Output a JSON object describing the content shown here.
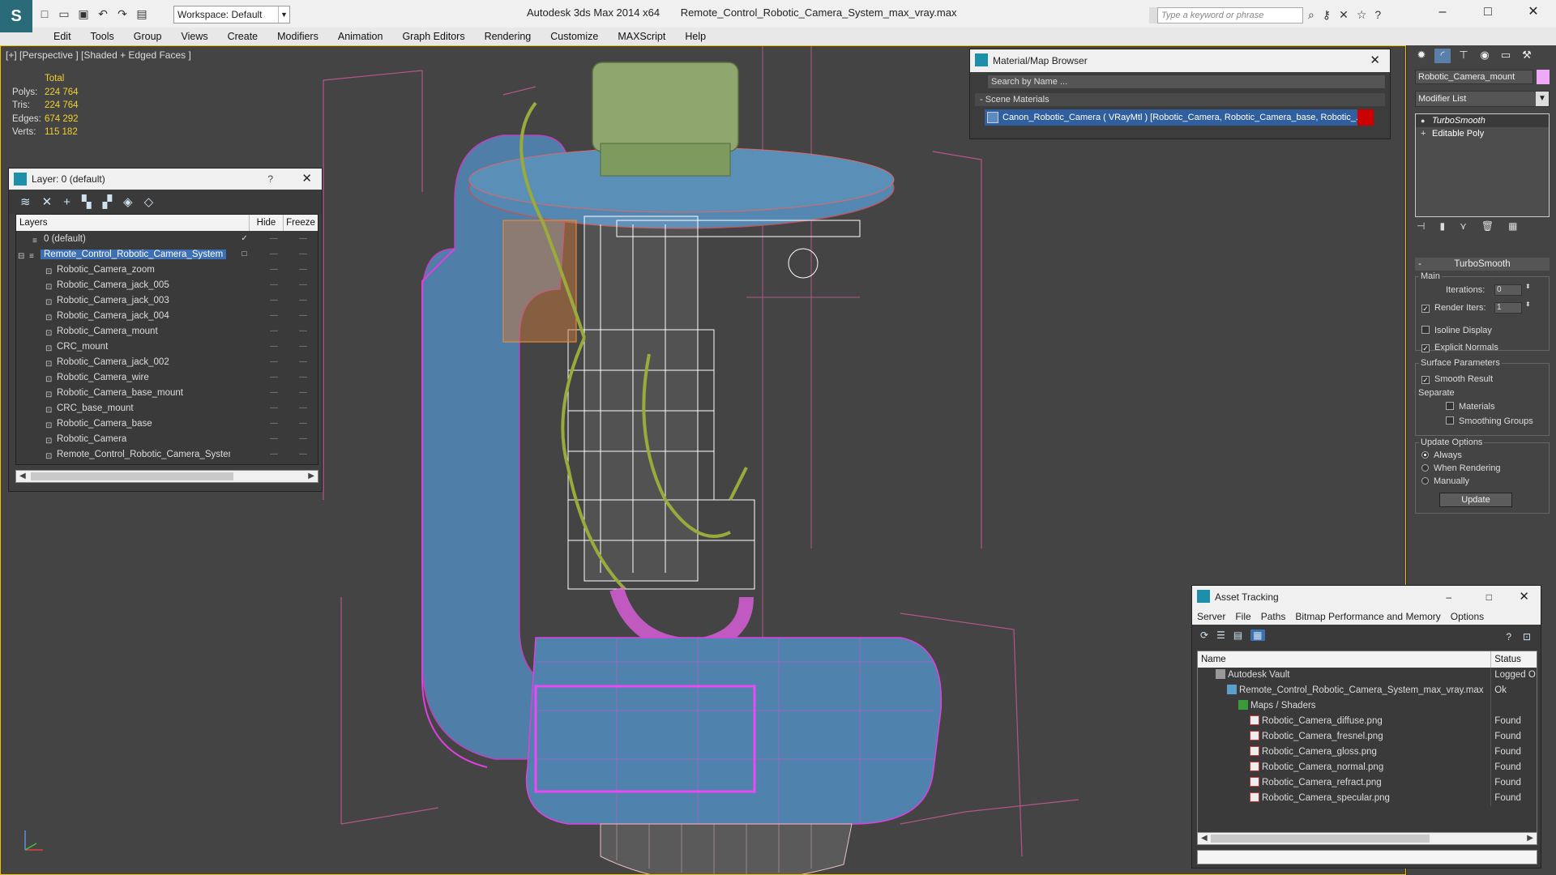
{
  "titlebar": {
    "workspace": "Workspace: Default",
    "app_name": "Autodesk 3ds Max  2014 x64",
    "file_name": "Remote_Control_Robotic_Camera_System_max_vray.max",
    "search_placeholder": "Type a keyword or phrase"
  },
  "menu": [
    "Edit",
    "Tools",
    "Group",
    "Views",
    "Create",
    "Modifiers",
    "Animation",
    "Graph Editors",
    "Rendering",
    "Customize",
    "MAXScript",
    "Help"
  ],
  "viewport": {
    "label": "[+] [Perspective ] [Shaded + Edged Faces ]",
    "stats": {
      "header": "Total",
      "polys_label": "Polys:",
      "polys": "224 764",
      "tris_label": "Tris:",
      "tris": "224 764",
      "edges_label": "Edges:",
      "edges": "674 292",
      "verts_label": "Verts:",
      "verts": "115 182"
    }
  },
  "layer_panel": {
    "title": "Layer: 0 (default)",
    "help": "?",
    "col_layers": "Layers",
    "col_hide": "Hide",
    "col_freeze": "Freeze",
    "dash": "—",
    "rows": [
      {
        "name": "0 (default)"
      },
      {
        "name": "Remote_Control_Robotic_Camera_System"
      },
      {
        "name": "Robotic_Camera_zoom"
      },
      {
        "name": "Robotic_Camera_jack_005"
      },
      {
        "name": "Robotic_Camera_jack_003"
      },
      {
        "name": "Robotic_Camera_jack_004"
      },
      {
        "name": "Robotic_Camera_mount"
      },
      {
        "name": "CRC_mount"
      },
      {
        "name": "Robotic_Camera_jack_002"
      },
      {
        "name": "Robotic_Camera_wire"
      },
      {
        "name": "Robotic_Camera_base_mount"
      },
      {
        "name": "CRC_base_mount"
      },
      {
        "name": "Robotic_Camera_base"
      },
      {
        "name": "Robotic_Camera"
      },
      {
        "name": "Remote_Control_Robotic_Camera_System"
      }
    ]
  },
  "material_browser": {
    "title": "Material/Map Browser",
    "search_placeholder": "Search by Name ...",
    "section": "Scene Materials",
    "item": "Canon_Robotic_Camera ( VRayMtl ) [Robotic_Camera, Robotic_Camera_base, Robotic_..."
  },
  "command_panel": {
    "object_name": "Robotic_Camera_mount",
    "object_color": "#f0a8f8",
    "modifier_list": "Modifier List",
    "stack": [
      "TurboSmooth",
      "Editable Poly"
    ],
    "rollout": "TurboSmooth",
    "main_label": "Main",
    "iterations_label": "Iterations:",
    "iterations": "0",
    "render_iters_label": "Render Iters:",
    "render_iters": "1",
    "isoline": "Isoline Display",
    "explicit_normals": "Explicit Normals",
    "surface_params": "Surface Parameters",
    "smooth_result": "Smooth Result",
    "separate": "Separate",
    "materials": "Materials",
    "smoothing_groups": "Smoothing Groups",
    "update_options": "Update Options",
    "always": "Always",
    "when_rendering": "When Rendering",
    "manually": "Manually",
    "update_btn": "Update"
  },
  "asset_tracking": {
    "title": "Asset Tracking",
    "menu": [
      "Server",
      "File",
      "Paths",
      "Bitmap Performance and Memory",
      "Options"
    ],
    "col_name": "Name",
    "col_status": "Status",
    "rows": [
      {
        "name": "Autodesk Vault",
        "status": "Logged O",
        "indent": 22,
        "icon": "ic-vault"
      },
      {
        "name": "Remote_Control_Robotic_Camera_System_max_vray.max",
        "status": "Ok",
        "indent": 36,
        "icon": "ic-max"
      },
      {
        "name": "Maps / Shaders",
        "status": "",
        "indent": 50,
        "icon": "ic-folder"
      },
      {
        "name": "Robotic_Camera_diffuse.png",
        "status": "Found",
        "indent": 64,
        "icon": "ic-png"
      },
      {
        "name": "Robotic_Camera_fresnel.png",
        "status": "Found",
        "indent": 64,
        "icon": "ic-png"
      },
      {
        "name": "Robotic_Camera_gloss.png",
        "status": "Found",
        "indent": 64,
        "icon": "ic-png"
      },
      {
        "name": "Robotic_Camera_normal.png",
        "status": "Found",
        "indent": 64,
        "icon": "ic-png"
      },
      {
        "name": "Robotic_Camera_refract.png",
        "status": "Found",
        "indent": 64,
        "icon": "ic-png"
      },
      {
        "name": "Robotic_Camera_specular.png",
        "status": "Found",
        "indent": 64,
        "icon": "ic-png"
      }
    ]
  }
}
